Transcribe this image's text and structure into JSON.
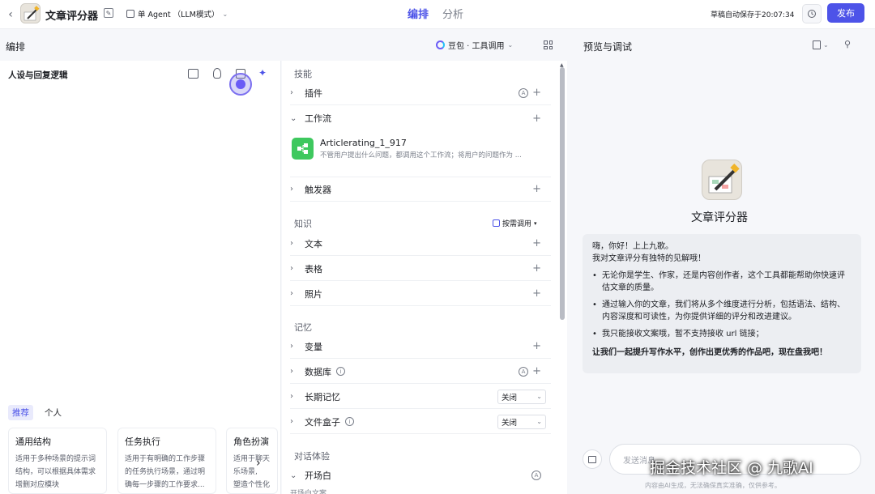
{
  "topbar": {
    "back_icon": "chevron-left-icon",
    "app_title": "文章评分器",
    "edit_icon": "edit-icon",
    "agent_mode": "单 Agent （LLM模式）",
    "tabs": [
      "编排",
      "分析"
    ],
    "autosave": "草稿自动保存于20:07:34",
    "history_icon": "history-icon",
    "publish_label": "发布",
    "accent": "#4d53e8"
  },
  "secbar": {
    "left_title": "编排",
    "model_label": "豆包 · 工具调用",
    "right_title": "预览与调试"
  },
  "persona": {
    "title": "人设与回复逻辑",
    "tabs": [
      "推荐",
      "个人"
    ],
    "cards": [
      {
        "title": "通用结构",
        "desc": [
          "适用于多种场景的提示词",
          "结构，可以根据具体需求",
          "增删对应模块"
        ]
      },
      {
        "title": "任务执行",
        "desc": [
          "适用于有明确的工作步骤",
          "的任务执行场景，通过明",
          "确每一步骤的工作要求..."
        ]
      },
      {
        "title": "角色扮演",
        "desc": [
          "适用于聊天",
          "乐场景,",
          "塑造个性化"
        ]
      }
    ]
  },
  "skills": {
    "section_label": "技能",
    "plugin_label": "插件",
    "workflow_label": "工作流",
    "workflow_item_name": "Articlerating_1_917",
    "workflow_item_desc": "不管用户提出什么问题，都调用这个工作流；将用户的问题作为 ...",
    "trigger_label": "触发器"
  },
  "knowledge": {
    "section_label": "知识",
    "call_mode": "按需调用",
    "items": [
      "文本",
      "表格",
      "照片"
    ]
  },
  "memory": {
    "section_label": "记忆",
    "variable_label": "变量",
    "database_label": "数据库",
    "long_memory_label": "长期记忆",
    "long_memory_value": "关闭",
    "filebox_label": "文件盒子",
    "filebox_value": "关闭"
  },
  "dialog": {
    "section_label": "对话体验",
    "opening_label": "开场白",
    "opening_sub": "开场白文案"
  },
  "preview": {
    "bot_name": "文章评分器",
    "greeting_1": "嗨，你好！上上九歌。",
    "greeting_2": "我对文章评分有独特的见解哦！",
    "bullets": [
      "无论你是学生、作家，还是内容创作者，这个工具都能帮助你快速评估文章的质量。",
      "通过输入你的文章，我们将从多个维度进行分析，包括语法、结构、内容深度和可读性，为你提供详细的评分和改进建议。",
      "我只能接收文案哦，暂不支持接收 url 链接；"
    ],
    "closing": "让我们一起提升写作水平，创作出更优秀的作品吧，现在盘我吧！",
    "input_placeholder": "发送消息...",
    "disclaimer": "内容由AI生成，无法确保真实准确，仅供参考。"
  },
  "watermark": "掘金技术社区 @ 九歌AI"
}
